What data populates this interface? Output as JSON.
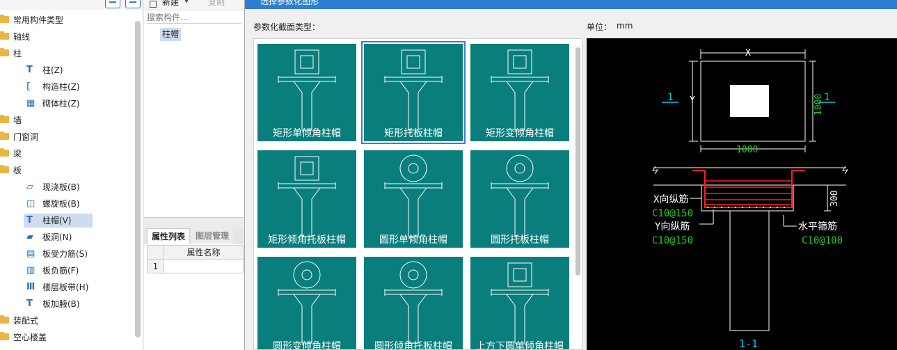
{
  "tree": {
    "nodes": [
      {
        "label": "常用构件类型",
        "type": "folder"
      },
      {
        "label": "轴线",
        "type": "folder"
      },
      {
        "label": "柱",
        "type": "folder"
      },
      {
        "label": "柱(Z)",
        "type": "leaf",
        "icon": "column-icon"
      },
      {
        "label": "构造柱(Z)",
        "type": "leaf",
        "icon": "constructional-column-icon"
      },
      {
        "label": "砌体柱(Z)",
        "type": "leaf",
        "icon": "masonry-column-icon"
      },
      {
        "label": "墙",
        "type": "folder"
      },
      {
        "label": "门窗洞",
        "type": "folder"
      },
      {
        "label": "梁",
        "type": "folder"
      },
      {
        "label": "板",
        "type": "folder"
      },
      {
        "label": "现浇板(B)",
        "type": "leaf",
        "icon": "cast-slab-icon"
      },
      {
        "label": "螺旋板(B)",
        "type": "leaf",
        "icon": "spiral-slab-icon"
      },
      {
        "label": "柱帽(V)",
        "type": "leaf",
        "icon": "column-cap-icon",
        "selected": true
      },
      {
        "label": "板洞(N)",
        "type": "leaf",
        "icon": "slab-hole-icon"
      },
      {
        "label": "板受力筋(S)",
        "type": "leaf",
        "icon": "slab-rebar-icon"
      },
      {
        "label": "板负筋(F)",
        "type": "leaf",
        "icon": "negative-rebar-icon"
      },
      {
        "label": "楼层板带(H)",
        "type": "leaf",
        "icon": "slab-strip-icon"
      },
      {
        "label": "板加腋(B)",
        "type": "leaf",
        "icon": "slab-haunch-icon"
      },
      {
        "label": "装配式",
        "type": "folder"
      },
      {
        "label": "空心楼盖",
        "type": "folder"
      }
    ]
  },
  "mid": {
    "new_label": "新建",
    "copy_label": "复制",
    "search_placeholder": "搜索构件...",
    "component": "柱帽",
    "tabs": {
      "properties": "属性列表",
      "layers": "图层管理"
    },
    "table_header": "属性名称",
    "row_number": "1"
  },
  "dialog": {
    "title": "选择参数化图形",
    "section_type_label": "参数化截面类型：",
    "unit_label": "单位：",
    "unit_value": "mm",
    "cards": [
      {
        "label": "矩形单倾角柱帽",
        "shape": "rect"
      },
      {
        "label": "矩形托板柱帽",
        "shape": "rect",
        "selected": true
      },
      {
        "label": "矩形变倾角柱帽",
        "shape": "rect"
      },
      {
        "label": "矩形倾角托板柱帽",
        "shape": "rect"
      },
      {
        "label": "圆形单倾角柱帽",
        "shape": "circle"
      },
      {
        "label": "圆形托板柱帽",
        "shape": "circle"
      },
      {
        "label": "圆形变倾角柱帽",
        "shape": "circle"
      },
      {
        "label": "圆形倾角托板柱帽",
        "shape": "circle"
      },
      {
        "label": "上方下圆单倾角柱帽",
        "shape": "rect"
      }
    ]
  },
  "preview": {
    "dim_x": "X",
    "dim_y": "Y",
    "dim_width": "1000",
    "dim_height": "1000",
    "section_mark": "1",
    "dim_depth": "300",
    "x_rebar_label": "X向纵筋",
    "x_rebar_value": "C10@150",
    "y_rebar_label": "Y向纵筋",
    "y_rebar_value": "C10@150",
    "hoop_label": "水平箍筋",
    "hoop_value": "C10@100",
    "section_title": "1-1"
  },
  "colors": {
    "card_bg": "#0a7e7c",
    "selection": "#3a7fd3",
    "title_bar": "#2d7fd3",
    "rebar_red": "#ff2020",
    "dim_green": "#22cc22",
    "mark_cyan": "#00c8e8"
  }
}
